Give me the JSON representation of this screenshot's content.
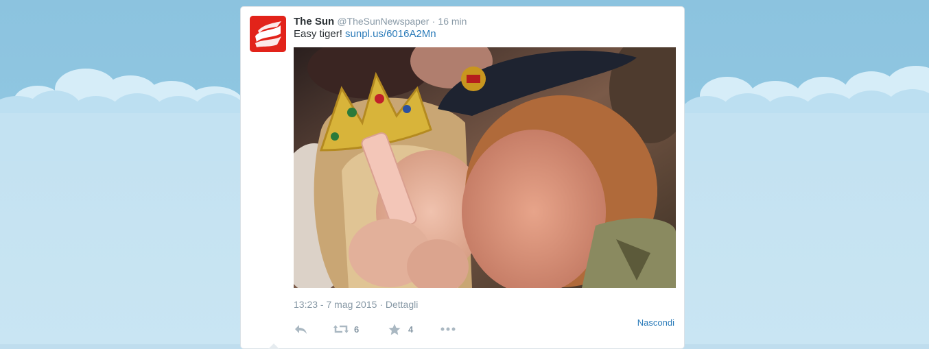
{
  "tweet": {
    "author_name": "The Sun",
    "handle": "@TheSunNewspaper",
    "separator": "·",
    "relative_time": "16 min",
    "text": "Easy tiger!",
    "link": "sunpl.us/6016A2Mn",
    "timestamp": "13:23 - 7 mag 2015",
    "details_label": "Dettagli",
    "retweet_count": "6",
    "favorite_count": "4",
    "hide_label": "Nascondi",
    "avatar_letter": "S"
  },
  "icons": [
    "reply-icon",
    "retweet-icon",
    "favorite-star-icon",
    "more-dots-icon"
  ],
  "colors": {
    "link": "#2b7bb9",
    "muted": "#8899a6",
    "avatar_bg": "#e2231a",
    "sky": "#8fc6e1"
  }
}
